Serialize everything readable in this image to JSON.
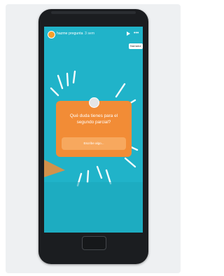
{
  "story": {
    "username": "hazme pregunta",
    "time": "3 sem",
    "notif_label": "Narrador"
  },
  "question_card": {
    "question": "Qué duda tienes para el segundo parcial?",
    "answer_placeholder": "Escribe algo..."
  },
  "icons": {
    "play": "play-icon",
    "more": "more-icon",
    "avatar": "avatar",
    "home": "home-button"
  },
  "colors": {
    "screen_bg": "#20b3c9",
    "card_bg": "#f28c36",
    "phone_body": "#1b1d20"
  }
}
